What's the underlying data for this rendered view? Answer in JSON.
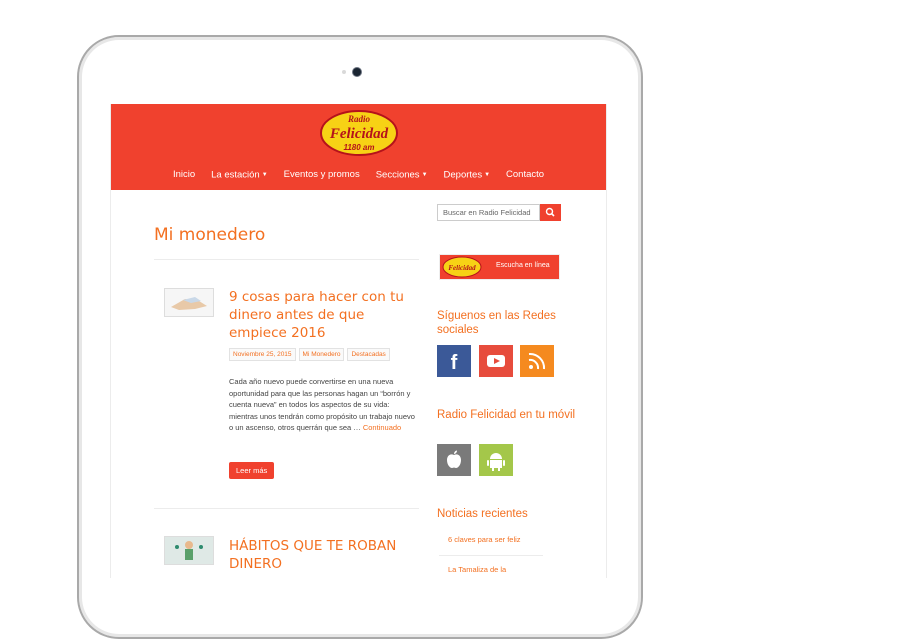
{
  "site": {
    "logo_text": [
      "Radio",
      "Felicidad",
      "1180 am"
    ],
    "nav": [
      {
        "label": "Inicio",
        "caret": false
      },
      {
        "label": "La estación",
        "caret": true
      },
      {
        "label": "Eventos y promos",
        "caret": false
      },
      {
        "label": "Secciones",
        "caret": true
      },
      {
        "label": "Deportes",
        "caret": true
      },
      {
        "label": "Contacto",
        "caret": false
      }
    ]
  },
  "main": {
    "page_title": "Mi monedero",
    "posts": [
      {
        "title": "9 cosas para hacer con tu dinero antes de que empiece 2016",
        "tags": [
          "Noviembre 25, 2015",
          "Mi Monedero",
          "Destacadas"
        ],
        "excerpt": "Cada año nuevo puede convertirse en una nueva oportunidad para que las personas hagan un “borrón y cuenta nueva” en todos los aspectos de su vida: mientras unos tendrán como propósito un trabajo nuevo o un ascenso, otros querrán que sea …",
        "more": "Continuado",
        "button": "Leer más"
      },
      {
        "title": "HÁBITOS QUE TE ROBAN DINERO"
      }
    ]
  },
  "sidebar": {
    "search_placeholder": "Buscar en Radio Felicidad",
    "banner_text": "Escucha en línea",
    "social_heading": "Síguenos en las Redes sociales",
    "mobile_heading": "Radio Felicidad en tu móvil",
    "recent_heading": "Noticias recientes",
    "recent": [
      "6 claves para ser feliz",
      "La Tamaliza de la"
    ]
  },
  "colors": {
    "brand": "#f0412e",
    "accent": "#f37021",
    "facebook": "#3b5998",
    "youtube": "#e74c3c",
    "rss": "#f58a1f",
    "apple": "#7a7a7a",
    "android": "#a4c74a"
  },
  "icons": [
    "search-icon",
    "facebook-icon",
    "youtube-icon",
    "rss-icon",
    "apple-icon",
    "android-icon"
  ]
}
